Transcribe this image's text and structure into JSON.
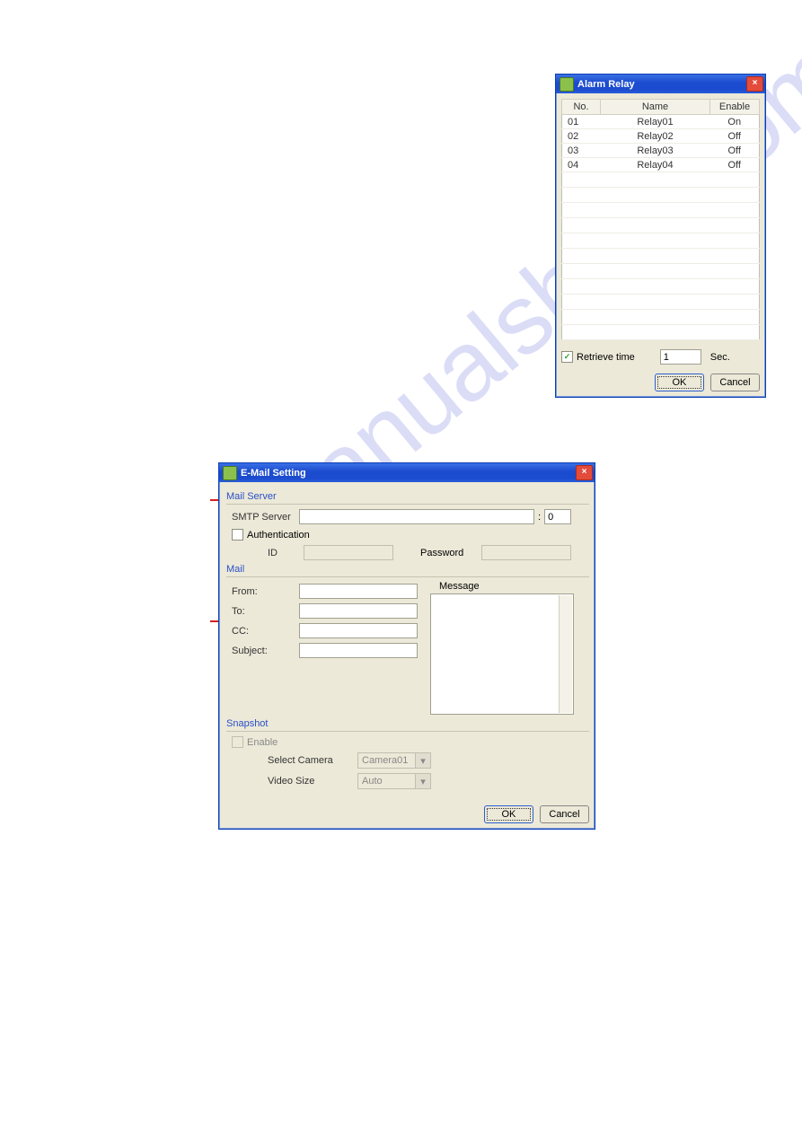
{
  "alarm_window": {
    "title": "Alarm Relay",
    "columns": {
      "no": "No.",
      "name": "Name",
      "enable": "Enable"
    },
    "rows": [
      {
        "no": "01",
        "name": "Relay01",
        "enable": "On"
      },
      {
        "no": "02",
        "name": "Relay02",
        "enable": "Off"
      },
      {
        "no": "03",
        "name": "Relay03",
        "enable": "Off"
      },
      {
        "no": "04",
        "name": "Relay04",
        "enable": "Off"
      }
    ],
    "retrieve_label": "Retrieve time",
    "retrieve_value": "1",
    "retrieve_unit": "Sec.",
    "ok": "OK",
    "cancel": "Cancel"
  },
  "email_window": {
    "title": "E-Mail Setting",
    "mail_server_header": "Mail Server",
    "smtp_label": "SMTP Server",
    "smtp_value": "",
    "port_sep": ":",
    "port_value": "0",
    "auth_label": "Authentication",
    "id_label": "ID",
    "id_value": "",
    "pw_label": "Password",
    "pw_value": "",
    "mail_header": "Mail",
    "message_label": "Message",
    "from_label": "From:",
    "to_label": "To:",
    "cc_label": "CC:",
    "subject_label": "Subject:",
    "snapshot_header": "Snapshot",
    "enable_label": "Enable",
    "camera_label": "Select Camera",
    "camera_value": "Camera01",
    "size_label": "Video Size",
    "size_value": "Auto",
    "ok": "OK",
    "cancel": "Cancel"
  }
}
